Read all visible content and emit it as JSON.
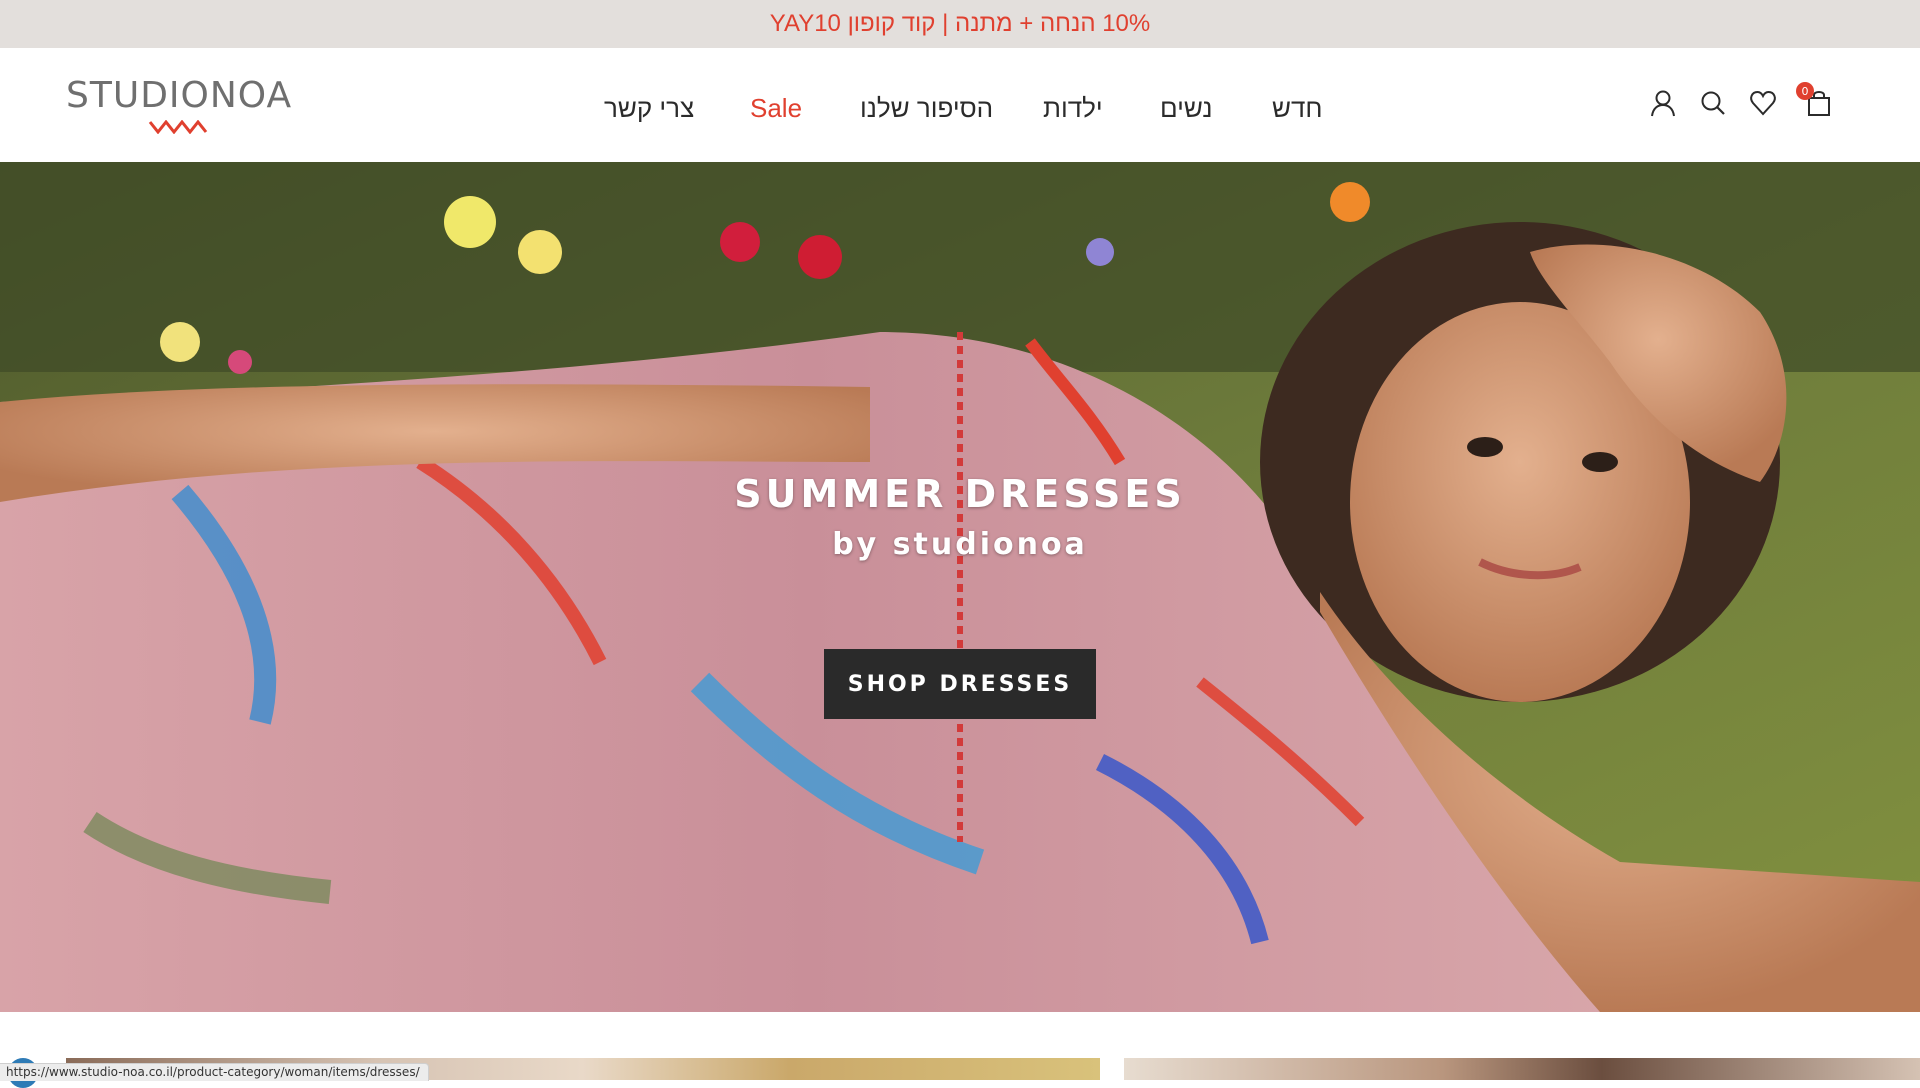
{
  "announcement": {
    "text": "10% הנחה + מתנה | קוד קופון YAY10"
  },
  "header": {
    "logo_text": "STUDIONOA",
    "nav": [
      {
        "label": "חדש"
      },
      {
        "label": "נשים"
      },
      {
        "label": "ילדות"
      },
      {
        "label": "הסיפור שלנו"
      },
      {
        "label": "Sale"
      },
      {
        "label": "צרי קשר"
      }
    ],
    "cart_count": "0",
    "icons": [
      "account-icon",
      "search-icon",
      "heart-icon",
      "shopping-bag-icon"
    ]
  },
  "hero": {
    "title": "SUMMER DRESSES",
    "subtitle": "by studionoa",
    "button_label": "SHOP DRESSES"
  },
  "status_bar": {
    "url": "https://www.studio-noa.co.il/product-category/woman/items/dresses/"
  },
  "colors": {
    "accent": "#e0402f",
    "announce_bg": "#e3dfdc",
    "button_bg": "#2a2a2a"
  }
}
